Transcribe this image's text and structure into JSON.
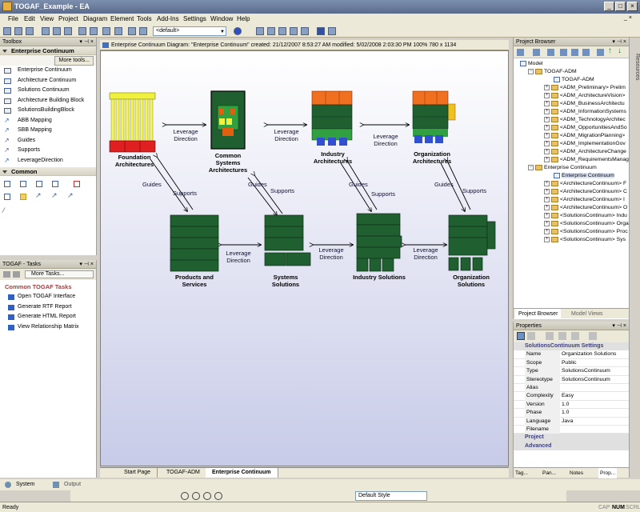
{
  "window": {
    "title": "TOGAF_Example - EA"
  },
  "menu": [
    "File",
    "Edit",
    "View",
    "Project",
    "Diagram",
    "Element",
    "Tools",
    "Add-Ins",
    "Settings",
    "Window",
    "Help"
  ],
  "toolbar": {
    "view_select": "<default>"
  },
  "toolbox": {
    "title": "Toolbox",
    "more_tools": "More tools...",
    "sections": [
      {
        "label": "Enterprise Continuum",
        "items": [
          "Enterprise Continuum",
          "Architecture Continuum",
          "Solutions Continuum",
          "Architecture Building Block",
          "SolutionsBuildingBlock",
          "ABB Mapping",
          "SBB Mapping",
          "Guides",
          "Supports",
          "LeverageDirection"
        ]
      },
      {
        "label": "Common",
        "items": []
      }
    ]
  },
  "tasks": {
    "title": "TOGAF - Tasks",
    "more_tasks": "More Tasks...",
    "section": "Common TOGAF Tasks",
    "items": [
      "Open TOGAF Interface",
      "Generate RTF Report",
      "Generate HTML Report",
      "View Relationship Matrix"
    ]
  },
  "diagram": {
    "header": "Enterprise Continuum Diagram: \"Enterprise Continuum\"   created: 21/12/2007 8:53:27 AM  modified: 5/02/2008 2:03:30 PM   100%   780 x 1134",
    "nodes": {
      "foundation": [
        "Foundation",
        "Architectures"
      ],
      "common": [
        "Common",
        "Systems",
        "Architectures"
      ],
      "industry_arch": [
        "Industry",
        "Architectures"
      ],
      "org_arch": [
        "Organization",
        "Architectures"
      ],
      "products": [
        "Products and",
        "Services"
      ],
      "systems": [
        "Systems",
        "Solutions"
      ],
      "industry_sol": [
        "Industry Solutions"
      ],
      "org_sol": [
        "Organization",
        "Solutions"
      ]
    },
    "connectors": {
      "leverage": [
        "Leverage",
        "Direction"
      ],
      "guides": "Guides",
      "supports": "Supports"
    }
  },
  "doc_tabs": [
    "Start Page",
    "TOGAF-ADM",
    "Enterprise Continuum"
  ],
  "project_browser": {
    "title": "Project Browser",
    "tabs": [
      "Project Browser",
      "Model Views"
    ],
    "tree": [
      {
        "level": 0,
        "label": "Model",
        "kind": "pkg"
      },
      {
        "level": 1,
        "label": "TOGAF-ADM",
        "kind": "fold"
      },
      {
        "level": 2,
        "label": "TOGAF-ADM",
        "kind": "pkg"
      },
      {
        "level": 2,
        "label": "<ADM_Preliminary> Prelim",
        "kind": "fold"
      },
      {
        "level": 2,
        "label": "<ADM_ArchitectureVision>",
        "kind": "fold"
      },
      {
        "level": 2,
        "label": "<ADM_BusinessArchitectu",
        "kind": "fold"
      },
      {
        "level": 2,
        "label": "<ADM_InformationSystems",
        "kind": "fold"
      },
      {
        "level": 2,
        "label": "<ADM_TechnologyArchitec",
        "kind": "fold"
      },
      {
        "level": 2,
        "label": "<ADM_OpportunitiesAndSo",
        "kind": "fold"
      },
      {
        "level": 2,
        "label": "<ADM_MigrationPlanning>",
        "kind": "fold"
      },
      {
        "level": 2,
        "label": "<ADM_ImplementationGov",
        "kind": "fold"
      },
      {
        "level": 2,
        "label": "<ADM_ArchitectureChange",
        "kind": "fold"
      },
      {
        "level": 2,
        "label": "<ADM_RequirementsManag",
        "kind": "fold"
      },
      {
        "level": 1,
        "label": "Enterprise Continuum",
        "kind": "fold"
      },
      {
        "level": 2,
        "label": "Enterprise Continuum",
        "kind": "pkg"
      },
      {
        "level": 2,
        "label": "<ArchitectureContinuum> F",
        "kind": "fold"
      },
      {
        "level": 2,
        "label": "<ArchitectureContinuum> C",
        "kind": "fold"
      },
      {
        "level": 2,
        "label": "<ArchitectureContinuum> I",
        "kind": "fold"
      },
      {
        "level": 2,
        "label": "<ArchitectureContinuum> O",
        "kind": "fold"
      },
      {
        "level": 2,
        "label": "<SolutionsContinuum> Indu",
        "kind": "fold"
      },
      {
        "level": 2,
        "label": "<SolutionsContinuum> Orga",
        "kind": "fold"
      },
      {
        "level": 2,
        "label": "<SolutionsContinuum> Proc",
        "kind": "fold"
      },
      {
        "level": 2,
        "label": "<SolutionsContinuum> Sys",
        "kind": "fold"
      }
    ]
  },
  "properties": {
    "title": "Properties",
    "section": "SolutionsContinuum Settings",
    "rows": [
      {
        "k": "Name",
        "v": "Organization Solutions"
      },
      {
        "k": "Scope",
        "v": "Public"
      },
      {
        "k": "Type",
        "v": "SolutionsContinuum"
      },
      {
        "k": "Stereotype",
        "v": "SolutionsContinuum"
      },
      {
        "k": "Alias",
        "v": ""
      },
      {
        "k": "Complexity",
        "v": "Easy"
      },
      {
        "k": "Version",
        "v": "1.0"
      },
      {
        "k": "Phase",
        "v": "1.0"
      },
      {
        "k": "Language",
        "v": "Java"
      },
      {
        "k": "Filename",
        "v": ""
      }
    ],
    "categories": [
      "Project",
      "Advanced"
    ],
    "tabs": [
      "Tag...",
      "Pan...",
      "Notes",
      "Prop..."
    ]
  },
  "side_tab": "Resources",
  "output_tabs": [
    "System",
    "Output"
  ],
  "bottom_toolbar": {
    "style_select": "Default Style"
  },
  "status": {
    "text": "Ready",
    "indicators": [
      "CAP",
      "NUM",
      "SCRL"
    ]
  }
}
